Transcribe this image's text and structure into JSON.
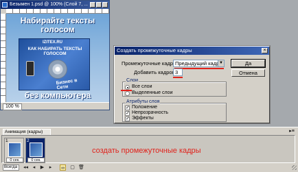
{
  "document_window": {
    "title": "Безымен 1.psd @ 100% (Слой 7, ...",
    "canvas": {
      "headline": "Набирайте тексты голосом",
      "box_site": "IZITEX.RU",
      "box_text": "КАК НАБИРАТЬ ТЕКСТЫ ГОЛОСОМ",
      "box_biz": "Бизнес в Сети",
      "bottom_text": "без компьютера"
    },
    "zoom": "100 %"
  },
  "dialog": {
    "title": "Создать промежуточные кадры",
    "tween_with_label": "Промежуточные кадры:",
    "tween_with_value": "Предыдущий кадр",
    "frames_to_add_label": "Добавить кадров:",
    "frames_to_add_value": "3",
    "ok_label": "Да",
    "cancel_label": "Отмена",
    "layers_group": {
      "legend": "Слои",
      "all_layers": "Все слои",
      "selected_layers": "Выделенные слои"
    },
    "params_group": {
      "legend": "Атрибуты слоя",
      "position": "Положение",
      "opacity": "Непрозрачность",
      "effects": "Эффекты"
    }
  },
  "animation_panel": {
    "tab_label": "Анимация (кадры)",
    "menu_glyph": "▸≡",
    "frames": [
      {
        "number": "1",
        "delay": "0 сек."
      },
      {
        "number": "2",
        "delay": "0 сек."
      }
    ],
    "loop_value": "Всегда",
    "annotation": "создать промежуточные кадры"
  },
  "colors": {
    "title_bar": "#0a246a",
    "annotation_red": "#e0231c",
    "dialog_bg": "#d4d0c8"
  }
}
